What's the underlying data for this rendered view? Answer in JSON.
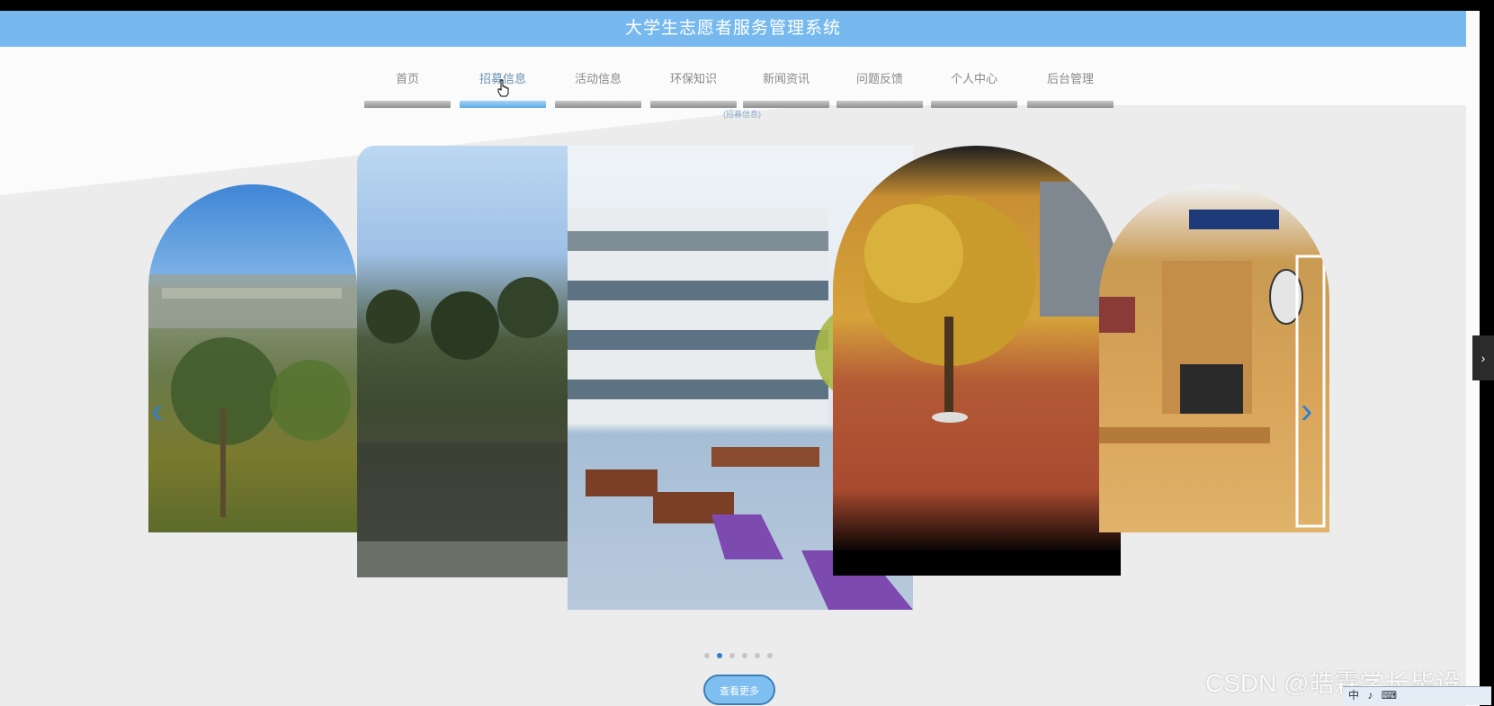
{
  "header": {
    "title": "大学生志愿者服务管理系统"
  },
  "nav": {
    "items": [
      {
        "label": "首页",
        "active": false
      },
      {
        "label": "招募信息",
        "active": true
      },
      {
        "label": "活动信息",
        "active": false
      },
      {
        "label": "环保知识",
        "active": false
      },
      {
        "label": "新闻资讯",
        "active": false
      },
      {
        "label": "问题反馈",
        "active": false
      },
      {
        "label": "个人中心",
        "active": false
      },
      {
        "label": "后台管理",
        "active": false
      }
    ]
  },
  "nav_sublink": "(招募信息)",
  "carousel": {
    "slides": [
      "campus-lawn",
      "lake-trees",
      "school-building-courtyard",
      "autumn-tree-plaza",
      "dorm-desk"
    ],
    "active_index": 1,
    "dot_count": 6,
    "prev_icon": "chevron-left-icon",
    "next_icon": "chevron-right-icon"
  },
  "more_button": {
    "label": "查看更多"
  },
  "side_tab": {
    "icon": "chevron-right-icon",
    "glyph": "›"
  },
  "watermark": "CSDN @皓霖学长毕设",
  "tray": {
    "items": [
      "中",
      "♪",
      "⌨"
    ]
  },
  "colors": {
    "accent": "#77b9ee",
    "active_dot": "#2f7fd0"
  }
}
